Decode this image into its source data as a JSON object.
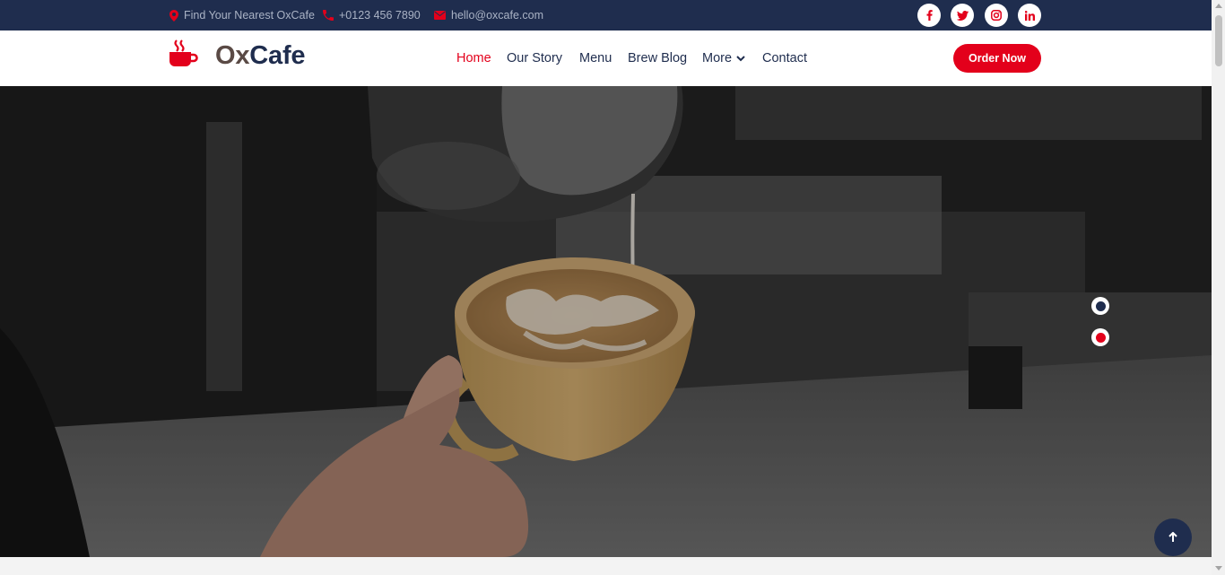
{
  "topbar": {
    "location_text": "Find Your Nearest OxCafe",
    "phone_text": "+0123 456 7890",
    "email_text": "hello@oxcafe.com",
    "social": [
      {
        "name": "facebook",
        "glyph": "f"
      },
      {
        "name": "twitter",
        "glyph": "t"
      },
      {
        "name": "instagram",
        "glyph": "ig"
      },
      {
        "name": "linkedin",
        "glyph": "in"
      }
    ]
  },
  "header": {
    "logo": {
      "part1": "Ox",
      "part2": "Cafe"
    },
    "nav": {
      "home": "Home",
      "story": "Our Story",
      "menu": "Menu",
      "blog": "Brew Blog",
      "more": "More",
      "contact": "Contact"
    },
    "order_button": "Order Now"
  },
  "hero": {
    "slider_dots": 2,
    "active_dot": 2
  },
  "colors": {
    "accent": "#e3001b",
    "navy": "#1f2d4e",
    "logo_brown": "#5a4a45"
  },
  "icons": {
    "location": "map-pin-icon",
    "phone": "phone-icon",
    "email": "envelope-icon",
    "more_dropdown": "chevron-down-icon",
    "back_to_top": "arrow-up-icon"
  }
}
